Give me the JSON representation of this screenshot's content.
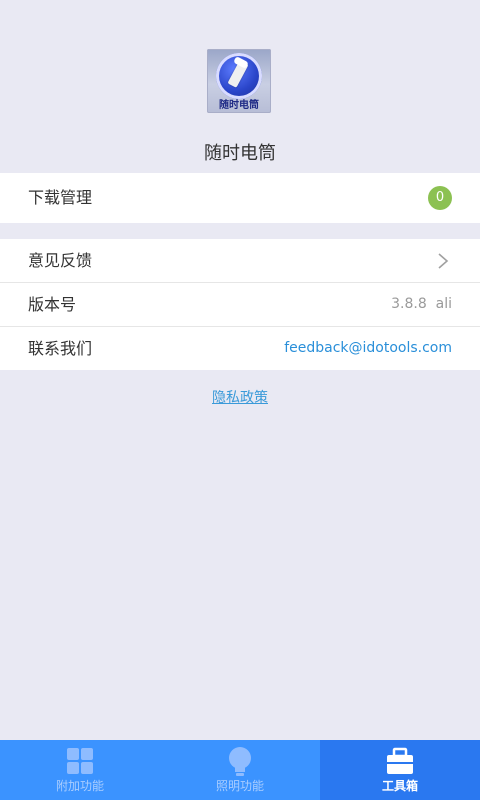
{
  "app": {
    "name": "随时电筒",
    "icon_caption": "随时电筒"
  },
  "downloads": {
    "label": "下载管理",
    "badge_count": "0"
  },
  "settings": {
    "feedback_label": "意见反馈",
    "version_label": "版本号",
    "version_value": "3.8.8  ali",
    "contact_label": "联系我们",
    "contact_email": "feedback@idotools.com"
  },
  "privacy": {
    "label": "隐私政策"
  },
  "tabs": [
    {
      "label": "附加功能",
      "icon": "grid-icon",
      "active": false
    },
    {
      "label": "照明功能",
      "icon": "lightbulb-icon",
      "active": false
    },
    {
      "label": "工具箱",
      "icon": "toolbox-icon",
      "active": true
    }
  ],
  "colors": {
    "background": "#e9e9f3",
    "tabbar": "#3b93ff",
    "tab_active": "#2a78f0",
    "badge": "#8cc152",
    "link": "#2a8fd9"
  }
}
